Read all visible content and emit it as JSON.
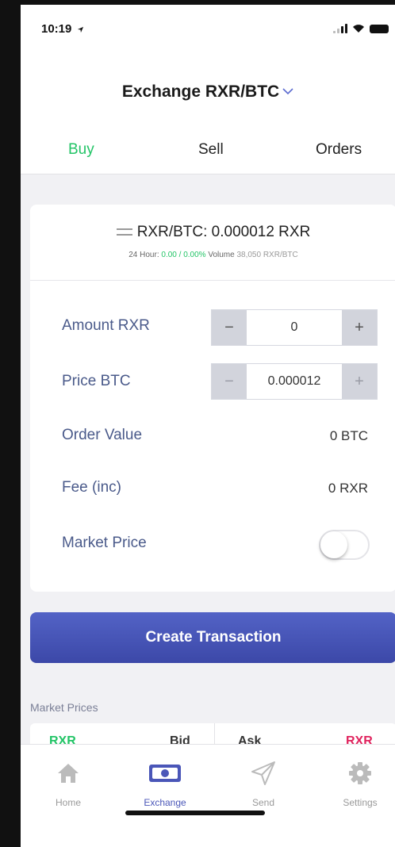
{
  "status": {
    "time": "10:19"
  },
  "header": {
    "title": "Exchange RXR/BTC"
  },
  "tabs": [
    {
      "label": "Buy"
    },
    {
      "label": "Sell"
    },
    {
      "label": "Orders"
    }
  ],
  "ticker": {
    "pair_text": "RXR/BTC: 0.000012 RXR",
    "hours_label": "24 Hour:",
    "change": "0.00 / 0.00%",
    "volume_label": "Volume",
    "volume": "38,050 RXR/BTC"
  },
  "form": {
    "amount": {
      "label": "Amount RXR",
      "value": "0",
      "minus": "−",
      "plus": "+"
    },
    "price": {
      "label": "Price BTC",
      "value": "0.000012",
      "minus": "−",
      "plus": "+"
    },
    "order_value": {
      "label": "Order Value",
      "value": "0 BTC"
    },
    "fee": {
      "label": "Fee (inc)",
      "value": "0 RXR"
    },
    "market_price": {
      "label": "Market Price",
      "enabled": false
    }
  },
  "create_button": "Create Transaction",
  "market_prices": {
    "label": "Market Prices",
    "col1": "RXR",
    "col2": "Bid",
    "col3": "Ask",
    "col4": "RXR"
  },
  "nav": [
    {
      "label": "Home",
      "icon": "home-icon"
    },
    {
      "label": "Exchange",
      "icon": "exchange-icon"
    },
    {
      "label": "Send",
      "icon": "send-icon"
    },
    {
      "label": "Settings",
      "icon": "gear-icon"
    }
  ],
  "colors": {
    "accent_green": "#22c466",
    "primary_blue": "#4a56b8",
    "ask_red": "#e0245e"
  }
}
